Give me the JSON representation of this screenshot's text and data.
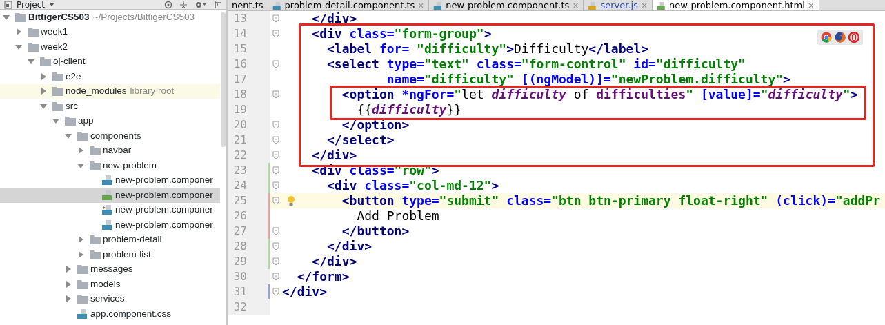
{
  "project_panel": {
    "title": "Project",
    "tree": [
      {
        "label": "BittigerCS503",
        "hint": "~/Projects/BittigerCS503",
        "kind": "root",
        "expanded": true,
        "selected": false,
        "children": [
          {
            "label": "week1",
            "kind": "folder",
            "expanded": false,
            "selected": false
          },
          {
            "label": "week2",
            "kind": "folder",
            "expanded": true,
            "selected": false,
            "children": [
              {
                "label": "oj-client",
                "kind": "folder",
                "expanded": true,
                "selected": false,
                "children": [
                  {
                    "label": "e2e",
                    "kind": "folder",
                    "expanded": false,
                    "selected": false
                  },
                  {
                    "label": "node_modules",
                    "hint": "library root",
                    "kind": "library",
                    "expanded": false,
                    "selected": false
                  },
                  {
                    "label": "src",
                    "kind": "folder",
                    "expanded": true,
                    "selected": false,
                    "children": [
                      {
                        "label": "app",
                        "kind": "folder",
                        "expanded": true,
                        "selected": false,
                        "children": [
                          {
                            "label": "components",
                            "kind": "folder",
                            "expanded": true,
                            "selected": false,
                            "children": [
                              {
                                "label": "navbar",
                                "kind": "folder",
                                "expanded": false,
                                "selected": false
                              },
                              {
                                "label": "new-problem",
                                "kind": "folder",
                                "expanded": true,
                                "selected": false,
                                "children": [
                                  {
                                    "label": "new-problem.componer",
                                    "kind": "css",
                                    "selected": false
                                  },
                                  {
                                    "label": "new-problem.componer",
                                    "kind": "html",
                                    "selected": true
                                  },
                                  {
                                    "label": "new-problem.componer",
                                    "kind": "spec",
                                    "selected": false
                                  },
                                  {
                                    "label": "new-problem.componer",
                                    "kind": "ts",
                                    "selected": false
                                  }
                                ]
                              },
                              {
                                "label": "problem-detail",
                                "kind": "folder",
                                "expanded": false,
                                "selected": false
                              },
                              {
                                "label": "problem-list",
                                "kind": "folder",
                                "expanded": false,
                                "selected": false
                              }
                            ]
                          },
                          {
                            "label": "messages",
                            "kind": "folder",
                            "expanded": false,
                            "selected": false
                          },
                          {
                            "label": "models",
                            "kind": "folder",
                            "expanded": false,
                            "selected": false
                          },
                          {
                            "label": "services",
                            "kind": "folder",
                            "expanded": false,
                            "selected": false
                          },
                          {
                            "label": "app.component.css",
                            "kind": "css",
                            "selected": false
                          }
                        ]
                      }
                    ]
                  }
                ]
              }
            ]
          }
        ]
      }
    ]
  },
  "editor": {
    "tabs": [
      {
        "label": "nent.ts",
        "kind": "none",
        "selected": false,
        "color": "#000000"
      },
      {
        "label": "problem-detail.component.ts",
        "kind": "ts",
        "selected": false,
        "color": "#000000",
        "close": "×"
      },
      {
        "label": "new-problem.component.ts",
        "kind": "ts",
        "selected": false,
        "color": "#000000",
        "close": "×"
      },
      {
        "label": "server.js",
        "kind": "js",
        "selected": false,
        "color": "#2b50b8",
        "close": "×"
      },
      {
        "label": "new-problem.component.html",
        "kind": "html",
        "selected": true,
        "color": "#000000",
        "close": "×"
      }
    ],
    "browser_icons": [
      {
        "kind": "chrome"
      },
      {
        "kind": "firefox"
      },
      {
        "kind": "opera"
      }
    ],
    "lines": [
      {
        "number": "13",
        "fold": true,
        "current": false,
        "outer_box": false,
        "inner_box": false,
        "tokens": [
          {
            "kind": "tag",
            "text": "    </div>"
          }
        ]
      },
      {
        "number": "14",
        "fold": true,
        "current": false,
        "outer_box": true,
        "inner_box": false,
        "tokens": [
          {
            "kind": "tag",
            "text": "    <div"
          },
          {
            "kind": "attr",
            "text": " class="
          },
          {
            "kind": "str",
            "text": "\"form-group\""
          },
          {
            "kind": "tag",
            "text": ">"
          }
        ]
      },
      {
        "number": "15",
        "fold": false,
        "current": false,
        "outer_box": true,
        "inner_box": false,
        "tokens": [
          {
            "kind": "tag",
            "text": "      <label"
          },
          {
            "kind": "attr",
            "text": " for="
          },
          {
            "kind": "str",
            "text": " \"difficulty\""
          },
          {
            "kind": "tag",
            "text": ">"
          },
          {
            "kind": "text",
            "text": "Difficulty"
          },
          {
            "kind": "tag",
            "text": "</label>"
          }
        ]
      },
      {
        "number": "16",
        "fold": true,
        "current": false,
        "outer_box": true,
        "inner_box": false,
        "tokens": [
          {
            "kind": "tag",
            "text": "      <select"
          },
          {
            "kind": "attr",
            "text": " type="
          },
          {
            "kind": "str",
            "text": "\"text\""
          },
          {
            "kind": "attr",
            "text": " class="
          },
          {
            "kind": "str",
            "text": "\"form-control\""
          },
          {
            "kind": "attr",
            "text": " id="
          },
          {
            "kind": "str",
            "text": "\"difficulty\""
          }
        ]
      },
      {
        "number": "17",
        "fold": false,
        "current": false,
        "outer_box": true,
        "inner_box": false,
        "tokens": [
          {
            "kind": "attr",
            "text": "              name="
          },
          {
            "kind": "str",
            "text": "\"difficulty\""
          },
          {
            "kind": "attr",
            "text": " [(ngModel)]="
          },
          {
            "kind": "str",
            "text": "\"newProblem.difficulty\""
          },
          {
            "kind": "tag",
            "text": ">"
          }
        ]
      },
      {
        "number": "18",
        "fold": true,
        "current": false,
        "outer_box": true,
        "inner_box": true,
        "tokens": [
          {
            "kind": "tag",
            "text": "        <option"
          },
          {
            "kind": "attr",
            "text": " *ngFor="
          },
          {
            "kind": "str",
            "text": "\""
          },
          {
            "kind": "text",
            "text": "let "
          },
          {
            "kind": "var",
            "text": "difficulty"
          },
          {
            "kind": "text",
            "text": " of "
          },
          {
            "kind": "ident",
            "text": "difficulties"
          },
          {
            "kind": "str",
            "text": "\""
          },
          {
            "kind": "attr",
            "text": " [value]="
          },
          {
            "kind": "str",
            "text": "\""
          },
          {
            "kind": "var",
            "text": "difficulty"
          },
          {
            "kind": "str",
            "text": "\""
          },
          {
            "kind": "tag",
            "text": ">"
          }
        ]
      },
      {
        "number": "19",
        "fold": false,
        "current": false,
        "outer_box": true,
        "inner_box": true,
        "tokens": [
          {
            "kind": "text",
            "text": "          {{"
          },
          {
            "kind": "var",
            "text": "difficulty"
          },
          {
            "kind": "text",
            "text": "}}"
          }
        ]
      },
      {
        "number": "20",
        "fold": true,
        "current": false,
        "outer_box": true,
        "inner_box": false,
        "tokens": [
          {
            "kind": "tag",
            "text": "        </option>"
          }
        ]
      },
      {
        "number": "21",
        "fold": true,
        "current": false,
        "outer_box": true,
        "inner_box": false,
        "tokens": [
          {
            "kind": "tag",
            "text": "      </select>"
          }
        ]
      },
      {
        "number": "22",
        "fold": true,
        "current": false,
        "outer_box": true,
        "inner_box": false,
        "tokens": [
          {
            "kind": "tag",
            "text": "    </div>"
          }
        ]
      },
      {
        "number": "23",
        "fold": true,
        "color": "#b5d9a4",
        "current": false,
        "outer_box": false,
        "inner_box": false,
        "tokens": [
          {
            "kind": "tag",
            "text": "    <div"
          },
          {
            "kind": "attr",
            "text": " class="
          },
          {
            "kind": "str",
            "text": "\"row\""
          },
          {
            "kind": "tag",
            "text": ">"
          }
        ]
      },
      {
        "number": "24",
        "fold": true,
        "color": "#b5d9a4",
        "current": false,
        "outer_box": false,
        "inner_box": false,
        "tokens": [
          {
            "kind": "tag",
            "text": "      <div"
          },
          {
            "kind": "attr",
            "text": " class="
          },
          {
            "kind": "str",
            "text": "\"col-md-12\""
          },
          {
            "kind": "tag",
            "text": ">"
          }
        ]
      },
      {
        "number": "25",
        "fold": true,
        "color": "#e4a7a7",
        "current": true,
        "outer_box": false,
        "inner_box": false,
        "tokens": [
          {
            "kind": "tag",
            "text": "        <button"
          },
          {
            "kind": "attr",
            "text": " type="
          },
          {
            "kind": "str",
            "text": "\"submit\""
          },
          {
            "kind": "attr",
            "text": " class="
          },
          {
            "kind": "str",
            "text": "\"btn btn-primary float-right\""
          },
          {
            "kind": "attr",
            "text": " (click)="
          },
          {
            "kind": "str",
            "text": "\"addPr"
          }
        ]
      },
      {
        "number": "26",
        "fold": false,
        "color": "#e4a7a7",
        "current": false,
        "outer_box": false,
        "inner_box": false,
        "tokens": [
          {
            "kind": "text",
            "text": "          Add Problem"
          }
        ]
      },
      {
        "number": "27",
        "fold": true,
        "color": "#e4a7a7",
        "current": false,
        "outer_box": false,
        "inner_box": false,
        "tokens": [
          {
            "kind": "tag",
            "text": "        </button>"
          }
        ]
      },
      {
        "number": "28",
        "fold": true,
        "color": "#b5d9a4",
        "current": false,
        "outer_box": false,
        "inner_box": false,
        "tokens": [
          {
            "kind": "tag",
            "text": "      </div>"
          }
        ]
      },
      {
        "number": "29",
        "fold": true,
        "color": "#b5d9a4",
        "current": false,
        "outer_box": false,
        "inner_box": false,
        "tokens": [
          {
            "kind": "tag",
            "text": "    </div>"
          }
        ]
      },
      {
        "number": "30",
        "fold": true,
        "current": false,
        "outer_box": false,
        "inner_box": false,
        "tokens": [
          {
            "kind": "tag",
            "text": "  </form>"
          }
        ]
      },
      {
        "number": "31",
        "fold": true,
        "color": "#9c9fd6",
        "current": false,
        "outer_box": false,
        "inner_box": false,
        "tokens": [
          {
            "kind": "tag",
            "text": "</div>"
          }
        ]
      },
      {
        "number": "32",
        "fold": false,
        "current": false,
        "outer_box": false,
        "inner_box": false
      }
    ]
  }
}
